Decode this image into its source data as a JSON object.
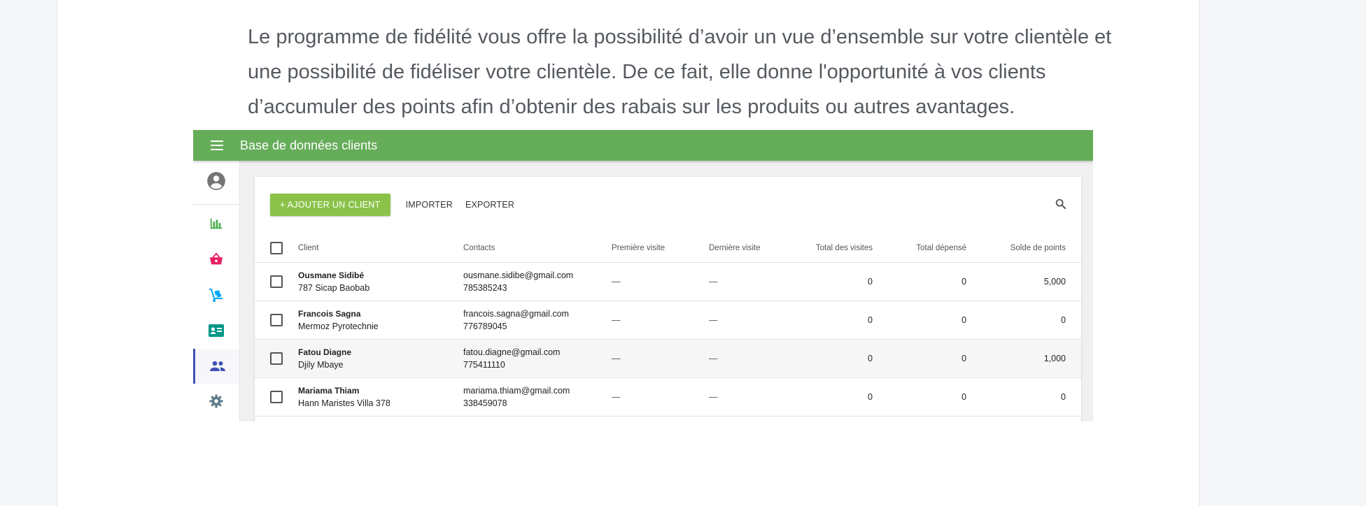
{
  "intro": {
    "line1": "Le programme de fidélité vous offre la possibilité d’avoir un vue d’ensemble sur votre clientèle et",
    "line2": "une possibilité de fidéliser votre clientèle. De ce fait, elle donne l'opportunité à vos clients",
    "line3": "d’accumuler des points afin d’obtenir des rabais sur les produits ou autres avantages."
  },
  "app": {
    "title": "Base de données clients",
    "accent": "#66ad5a"
  },
  "sidebar": {
    "items": [
      {
        "icon": "account-circle-icon",
        "color": "#757575"
      },
      {
        "icon": "bar-chart-icon",
        "color": "#4caf50"
      },
      {
        "icon": "basket-icon",
        "color": "#e91e63"
      },
      {
        "icon": "hand-truck-icon",
        "color": "#03a9f4"
      },
      {
        "icon": "contact-card-icon",
        "color": "#009688"
      },
      {
        "icon": "people-icon",
        "color": "#3f51b5",
        "active": true
      },
      {
        "icon": "gear-icon",
        "color": "#607d8b"
      }
    ]
  },
  "toolbar": {
    "add_label": "+ AJOUTER UN CLIENT",
    "import_label": "IMPORTER",
    "export_label": "EXPORTER"
  },
  "table": {
    "headers": {
      "client": "Client",
      "contacts": "Contacts",
      "first_visit": "Première visite",
      "last_visit": "Dernière visite",
      "total_visits": "Total des visites",
      "total_spent": "Total dépensé",
      "points": "Solde de points"
    },
    "rows": [
      {
        "name": "Ousmane Sidibé",
        "address": "787 Sicap Baobab",
        "email": "ousmane.sidibe@gmail.com",
        "phone": "785385243",
        "first_visit": "—",
        "last_visit": "—",
        "total_visits": "0",
        "total_spent": "0",
        "points": "5,000"
      },
      {
        "name": "Francois Sagna",
        "address": "Mermoz Pyrotechnie",
        "email": "francois.sagna@gmail.com",
        "phone": "776789045",
        "first_visit": "—",
        "last_visit": "—",
        "total_visits": "0",
        "total_spent": "0",
        "points": "0"
      },
      {
        "name": "Fatou Diagne",
        "address": "Djily Mbaye",
        "email": "fatou.diagne@gmail.com",
        "phone": "775411110",
        "first_visit": "—",
        "last_visit": "—",
        "total_visits": "0",
        "total_spent": "0",
        "points": "1,000"
      },
      {
        "name": "Mariama Thiam",
        "address": "Hann Maristes Villa 378",
        "email": "mariama.thiam@gmail.com",
        "phone": "338459078",
        "first_visit": "—",
        "last_visit": "—",
        "total_visits": "0",
        "total_spent": "0",
        "points": "0"
      }
    ]
  }
}
